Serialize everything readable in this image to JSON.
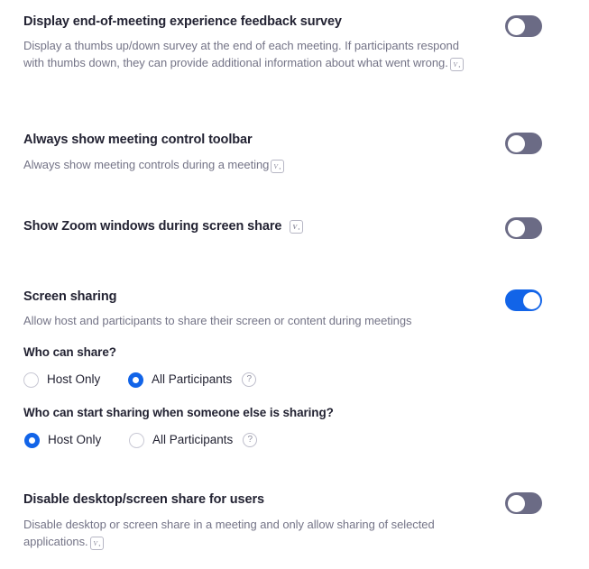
{
  "settings": [
    {
      "id": "end-of-meeting-survey",
      "title": "Display end-of-meeting experience feedback survey",
      "description": "Display a thumbs up/down survey at the end of each meeting. If participants respond with thumbs down, they can provide additional information about what went wrong.",
      "has_badge": true,
      "badge_glyph": "V",
      "toggle_state": "off"
    },
    {
      "id": "always-show-toolbar",
      "title": "Always show meeting control toolbar",
      "description": "Always show meeting controls during a meeting",
      "has_badge": true,
      "badge_glyph": "V",
      "toggle_state": "off"
    },
    {
      "id": "show-zoom-windows",
      "title": "Show Zoom windows during screen share",
      "description": "",
      "has_badge": true,
      "badge_glyph": "V",
      "toggle_state": "off"
    },
    {
      "id": "screen-sharing",
      "title": "Screen sharing",
      "description": "Allow host and participants to share their screen or content during meetings",
      "has_badge": false,
      "badge_glyph": "",
      "toggle_state": "on"
    },
    {
      "id": "disable-desktop-screen-share",
      "title": "Disable desktop/screen share for users",
      "description": "Disable desktop or screen share in a meeting and only allow sharing of selected applications.",
      "has_badge": true,
      "badge_glyph": "V",
      "toggle_state": "off"
    }
  ],
  "radio_groups": [
    {
      "id": "who-can-share",
      "label": "Who can share?",
      "options": [
        {
          "label": "Host Only",
          "selected": false
        },
        {
          "label": "All Participants",
          "selected": true
        }
      ],
      "help_label": "?"
    },
    {
      "id": "who-can-start-sharing",
      "label": "Who can start sharing when someone else is sharing?",
      "options": [
        {
          "label": "Host Only",
          "selected": true
        },
        {
          "label": "All Participants",
          "selected": false
        }
      ],
      "help_label": "?"
    }
  ],
  "colors": {
    "toggle_on": "#1264e8",
    "toggle_off": "#6b6b85",
    "radio_selected": "#1264e8",
    "title_text": "#232333",
    "description_text": "#747487",
    "background": "#ffffff"
  }
}
